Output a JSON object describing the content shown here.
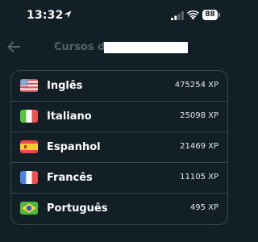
{
  "status_bar": {
    "time": "13:32",
    "battery": "88"
  },
  "header": {
    "title": "Cursos de"
  },
  "courses": [
    {
      "language": "Inglês",
      "xp": "475254 XP",
      "flag": "us-flag"
    },
    {
      "language": "Italiano",
      "xp": "25098 XP",
      "flag": "italy-flag"
    },
    {
      "language": "Espanhol",
      "xp": "21469 XP",
      "flag": "spain-flag"
    },
    {
      "language": "Francês",
      "xp": "11105 XP",
      "flag": "france-flag"
    },
    {
      "language": "Português",
      "xp": "495 XP",
      "flag": "brazil-flag"
    }
  ],
  "colors": {
    "background": "#121f26",
    "border": "#37464f",
    "title": "#52656d"
  }
}
